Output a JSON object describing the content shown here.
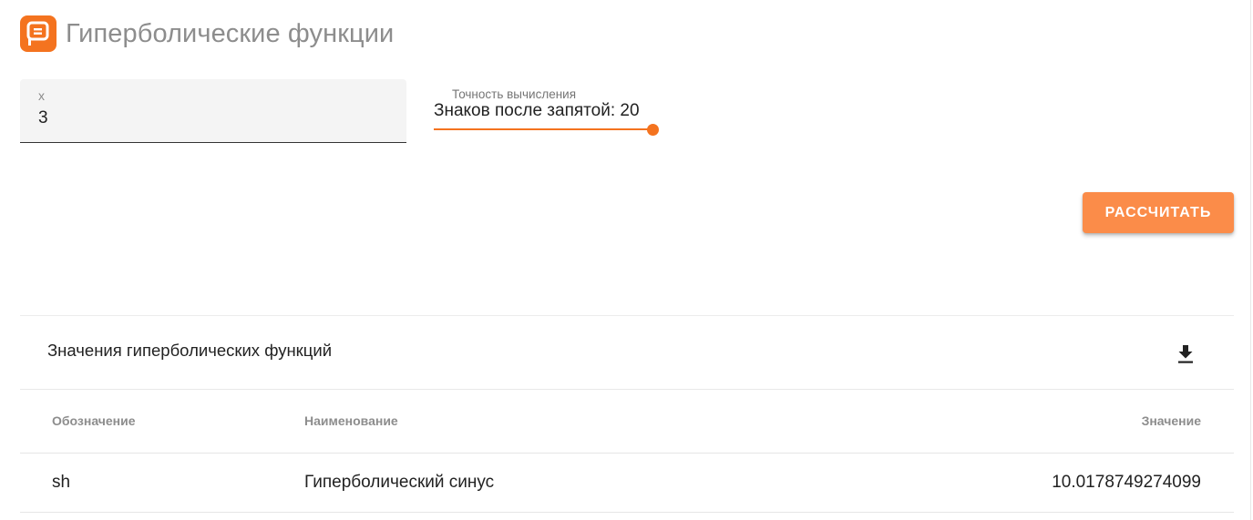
{
  "app": {
    "title": "Гиперболические функции",
    "logo_icon": "calculator-logo-icon",
    "accent_color": "#f4731f"
  },
  "input_x": {
    "label": "x",
    "value": "3"
  },
  "precision": {
    "label": "Точность вычисления",
    "value_text": "Знаков после запятой: 20",
    "value": 20,
    "fill_fraction": 1.0
  },
  "calculate_button": {
    "label": "РАССЧИТАТЬ",
    "color": "#fb8c49"
  },
  "results": {
    "title": "Значения гиперболических функций",
    "download_icon": "download-icon",
    "columns": [
      "Обозначение",
      "Наименование",
      "Значение"
    ],
    "rows": [
      {
        "symbol": "sh",
        "name": "Гиперболический синус",
        "value": "10.0178749274099"
      }
    ]
  }
}
